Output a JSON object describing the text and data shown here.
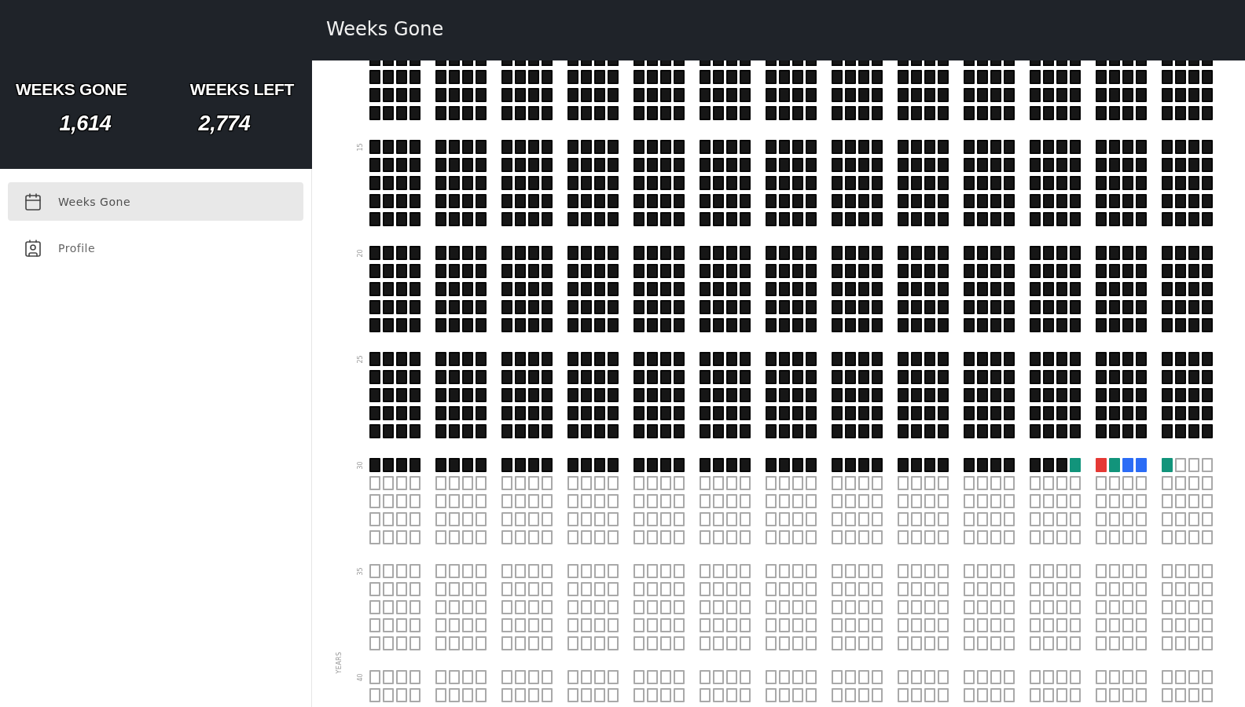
{
  "header": {
    "title": "Weeks Gone"
  },
  "stats": [
    {
      "label": "WEEKS GONE",
      "value": "1,614"
    },
    {
      "label": "WEEKS LEFT",
      "value": "2,774"
    }
  ],
  "nav": [
    {
      "label": "Weeks Gone",
      "selected": true
    },
    {
      "label": "Profile",
      "selected": false
    }
  ],
  "grid": {
    "axis_label": "YEARS",
    "bands": [
      {
        "years": [
          {
            "kind": "past"
          },
          {
            "kind": "past"
          },
          {
            "kind": "past"
          },
          {
            "kind": "past"
          }
        ]
      },
      {
        "label": "15",
        "years": [
          {
            "kind": "past"
          },
          {
            "kind": "past"
          },
          {
            "kind": "past"
          },
          {
            "kind": "past"
          },
          {
            "kind": "past"
          }
        ]
      },
      {
        "label": "20",
        "years": [
          {
            "kind": "past"
          },
          {
            "kind": "past"
          },
          {
            "kind": "past"
          },
          {
            "kind": "past"
          },
          {
            "kind": "past"
          }
        ]
      },
      {
        "label": "25",
        "years": [
          {
            "kind": "past"
          },
          {
            "kind": "past"
          },
          {
            "kind": "past"
          },
          {
            "kind": "past"
          },
          {
            "kind": "past"
          }
        ]
      },
      {
        "label": "30",
        "years": [
          {
            "kind": "current",
            "weeks": [
              {
                "kind": "past"
              },
              {
                "kind": "past"
              },
              {
                "kind": "past"
              },
              {
                "kind": "past"
              },
              {
                "kind": "past"
              },
              {
                "kind": "past"
              },
              {
                "kind": "past"
              },
              {
                "kind": "past"
              },
              {
                "kind": "past"
              },
              {
                "kind": "past"
              },
              {
                "kind": "past"
              },
              {
                "kind": "past"
              },
              {
                "kind": "past"
              },
              {
                "kind": "past"
              },
              {
                "kind": "past"
              },
              {
                "kind": "past"
              },
              {
                "kind": "past"
              },
              {
                "kind": "past"
              },
              {
                "kind": "past"
              },
              {
                "kind": "past"
              },
              {
                "kind": "past"
              },
              {
                "kind": "past"
              },
              {
                "kind": "past"
              },
              {
                "kind": "past"
              },
              {
                "kind": "past"
              },
              {
                "kind": "past"
              },
              {
                "kind": "past"
              },
              {
                "kind": "past"
              },
              {
                "kind": "past"
              },
              {
                "kind": "past"
              },
              {
                "kind": "past"
              },
              {
                "kind": "past"
              },
              {
                "kind": "past"
              },
              {
                "kind": "past"
              },
              {
                "kind": "past"
              },
              {
                "kind": "past"
              },
              {
                "kind": "past"
              },
              {
                "kind": "past"
              },
              {
                "kind": "past"
              },
              {
                "kind": "past"
              },
              {
                "kind": "past"
              },
              {
                "kind": "past"
              },
              {
                "kind": "past"
              },
              {
                "kind": "event",
                "color": "#12947b"
              },
              {
                "kind": "event",
                "color": "#e53935"
              },
              {
                "kind": "event",
                "color": "#12947b"
              },
              {
                "kind": "event",
                "color": "#2b6cf6"
              },
              {
                "kind": "event",
                "color": "#2b6cf6"
              },
              {
                "kind": "event",
                "color": "#12947b"
              },
              {
                "kind": "future"
              },
              {
                "kind": "future"
              },
              {
                "kind": "future"
              }
            ]
          },
          {
            "kind": "future"
          },
          {
            "kind": "future"
          },
          {
            "kind": "future"
          },
          {
            "kind": "future"
          }
        ]
      },
      {
        "label": "35",
        "years": [
          {
            "kind": "future"
          },
          {
            "kind": "future"
          },
          {
            "kind": "future"
          },
          {
            "kind": "future"
          },
          {
            "kind": "future"
          }
        ]
      },
      {
        "label": "40",
        "years": [
          {
            "kind": "future"
          },
          {
            "kind": "future"
          }
        ]
      }
    ]
  }
}
